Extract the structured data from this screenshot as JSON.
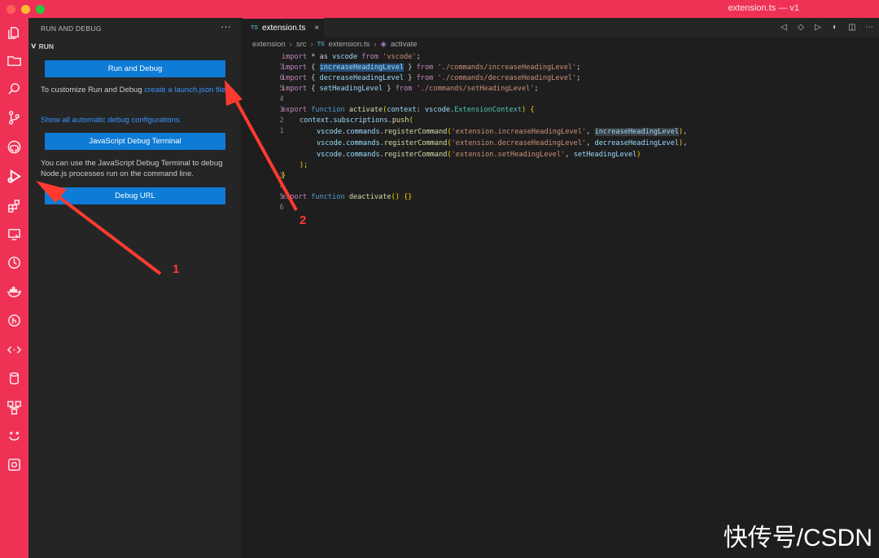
{
  "window": {
    "title": "extension.ts — v1"
  },
  "sidebar": {
    "header": "RUN AND DEBUG",
    "more": "···",
    "section": "RUN",
    "run_button": "Run and Debug",
    "customize_text": "To customize Run and Debug ",
    "customize_link": "create a launch.json file",
    "customize_end": ".",
    "show_all_link": "Show all automatic debug configurations.",
    "js_terminal_button": "JavaScript Debug Terminal",
    "js_terminal_text": "You can use the JavaScript Debug Terminal to debug Node.js processes run on the command line.",
    "debug_url_button": "Debug URL"
  },
  "tab": {
    "badge": "TS",
    "label": "extension.ts",
    "close": "×"
  },
  "breadcrumb": {
    "items": [
      "extension",
      "src",
      "extension.ts",
      "activate"
    ],
    "file_badge": "TS"
  },
  "editor": {
    "line_numbers": [
      "7",
      "6",
      "5",
      "4",
      "3",
      "2",
      "1",
      "",
      "",
      "",
      "3",
      "4",
      "5",
      "6"
    ],
    "lines": {
      "l1": [
        "import",
        " * as ",
        "vscode",
        " from ",
        "'vscode'",
        ";"
      ],
      "l2": [
        "import",
        " { ",
        "increaseHeadingLevel",
        " } ",
        "from",
        " ",
        "'./commands/increaseHeadingLevel'",
        ";"
      ],
      "l3": [
        "import",
        " { ",
        "decreaseHeadingLevel",
        " } ",
        "from",
        " ",
        "'./commands/decreaseHeadingLevel'",
        ";"
      ],
      "l4": [
        "import",
        " { ",
        "setHeadingLevel",
        " } ",
        "from",
        " ",
        "'./commands/setHeadingLevel'",
        ";"
      ],
      "l6": [
        "export",
        " ",
        "function",
        " ",
        "activate",
        "(",
        "context",
        ": ",
        "vscode",
        ".",
        "ExtensionContext",
        ") {"
      ],
      "l7": [
        "context",
        ".",
        "subscriptions",
        ".",
        "push",
        "("
      ],
      "l8": [
        "vscode",
        ".",
        "commands",
        ".",
        "registerCommand",
        "(",
        "'extension.increaseHeadingLevel'",
        ", ",
        "increaseHeadingLevel",
        ")",
        ","
      ],
      "l9": [
        "vscode",
        ".",
        "commands",
        ".",
        "registerCommand",
        "(",
        "'extension.decreaseHeadingLevel'",
        ", ",
        "decreaseHeadingLevel",
        ")",
        ","
      ],
      "l10": [
        "vscode",
        ".",
        "commands",
        ".",
        "registerCommand",
        "(",
        "'extension.setHeadingLevel'",
        ", ",
        "setHeadingLevel",
        ")"
      ],
      "l11": [
        ");"
      ],
      "l12": [
        "}"
      ],
      "l14": [
        "export",
        " ",
        "function",
        " ",
        "deactivate",
        "() {}"
      ]
    }
  },
  "annotations": {
    "one": "1",
    "two": "2"
  },
  "watermark": "快传号/CSDN",
  "colors": {
    "activity_bar": "#ef3156",
    "button": "#0e7bd6",
    "arrow": "#ff3b30"
  }
}
